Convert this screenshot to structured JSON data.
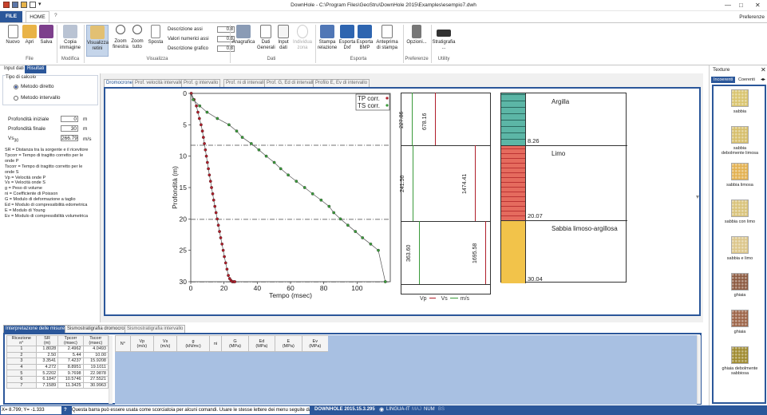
{
  "window": {
    "title": "DownHole - C:\\Program Files\\GeoStru\\DownHole 2015\\Examples\\esempio7.dwh"
  },
  "tabs": {
    "file": "FILE",
    "home": "HOME",
    "help": "?",
    "preferences": "Preferenze"
  },
  "ribbon": {
    "buttons": {
      "nuovo": "Nuovo",
      "apri": "Apri",
      "salva": "Salva",
      "copia": "Copia\nimmagine",
      "visualizza": "Visualizza\nretini",
      "zoomf": "Zoom\nfinestra",
      "zoomt": "Zoom\ntutto",
      "sposta": "Sposta",
      "anagrafica": "Anagrafica",
      "dati": "Dati\nGenerali",
      "input": "Input\ndati",
      "individua": "Individua\nzona",
      "stampa": "Stampa\nrelazione",
      "dxf": "Esporta\nDxf",
      "bmp": "Esporta\nBMP",
      "anteprima": "Anteprima\ndi stampa",
      "opzioni": "Opzioni...",
      "strat": "Stratigrafia\n..."
    },
    "fields": [
      {
        "label": "Descrizione assi",
        "value": "0.8"
      },
      {
        "label": "Valori numerici assi",
        "value": "0.8"
      },
      {
        "label": "Descrizione grafico",
        "value": "0.8"
      }
    ],
    "groups": {
      "file": "File",
      "modifica": "Modifica",
      "visualizza": "Visualizza",
      "dati": "Dati",
      "esporta": "Esporta",
      "preferenze": "Preferenze",
      "utility": "Utility"
    }
  },
  "left": {
    "tabs": [
      "Input dati",
      "Risultati"
    ],
    "section": "Tipo di calcolo",
    "radio": [
      "Metodo diretto",
      "Metodo intervallo"
    ],
    "params": [
      {
        "label": "Profondità iniziale",
        "value": "0",
        "unit": "m"
      },
      {
        "label": "Profondità finale",
        "value": "30",
        "unit": "m"
      },
      {
        "label": "Vs",
        "sub": "30",
        "value": "266.79",
        "unit": "m/s"
      }
    ],
    "legend": [
      "SR = Distanza tra la sorgente e il ricevitore",
      "Tpcorr = Tempo di tragitto corretto per le",
      "onde P",
      "Tscorr = Tempo di tragitto corretto per le",
      "onde S",
      "Vp = Velocità onde P",
      "Vs = Velocità onde S",
      "g = Peso di volume",
      "ni = Coefficiente di Poisson",
      "G = Modulo di deformazione a taglio",
      "Ed = Modulo di compressibilità edometrica",
      "E = Modulo di Young",
      "Ev = Modulo di compressibilità volumetrica"
    ]
  },
  "plot_tabs": [
    "Dromocrone",
    "Prof. velocità intervallo",
    "Prof. g intervallo",
    "Prof. ni di intervallo",
    "Prof. G, Ed di intervallo",
    "Profilo E, Ev di intervallo"
  ],
  "chart_data": {
    "type": "scatter",
    "xlabel": "Tempo (msec)",
    "ylabel": "Profondità (m)",
    "xlim": [
      0,
      120
    ],
    "ylim": [
      30,
      0
    ],
    "xticks": [
      "0",
      "20",
      "40",
      "60",
      "80",
      "100"
    ],
    "yticks": [
      "0",
      "5",
      "10",
      "15",
      "20",
      "25",
      "30"
    ],
    "legend_position": "top-right",
    "grid": false,
    "series": [
      {
        "name": "TP corr.",
        "color": "#b01e2a",
        "x": [
          0.3,
          2.0,
          3.4,
          4.3,
          5.2,
          6.2,
          7.0,
          7.6,
          8.2,
          8.8,
          9.4,
          10.0,
          10.6,
          11.2,
          11.9,
          12.5,
          13.2,
          13.8,
          14.5,
          15.2,
          15.9,
          16.6,
          17.3,
          18.0,
          18.8,
          19.5,
          20.2,
          21.0,
          21.8,
          22.6,
          23.4,
          24.2,
          25.0,
          25.8,
          26.5
        ],
        "y": [
          0,
          1,
          2,
          3,
          4,
          5,
          6,
          7,
          8,
          9,
          10,
          11,
          12,
          13,
          14,
          15,
          16,
          17,
          18,
          19,
          20,
          21,
          22,
          23,
          24,
          25,
          26,
          27,
          28,
          29,
          29.5,
          29.8,
          30,
          30,
          30
        ]
      },
      {
        "name": "TS corr.",
        "color": "#3a9a3a",
        "x": [
          1.5,
          5.4,
          9.8,
          16,
          23,
          27.6,
          31,
          36.4,
          41,
          45.4,
          50.2,
          54.1,
          58.6,
          63.5,
          68.5,
          73.3,
          78.4,
          83.2,
          86,
          90,
          94.5,
          99,
          103.3,
          108.2,
          112.8,
          117
        ],
        "y": [
          1,
          2,
          3,
          4,
          5,
          6,
          7,
          8,
          9,
          10,
          11,
          12,
          13,
          14,
          15,
          16,
          17,
          18,
          19,
          20,
          21,
          22,
          23,
          24,
          25,
          30
        ]
      }
    ],
    "annotations": [
      "8.26",
      "20.07",
      "30.04"
    ]
  },
  "strata": [
    {
      "name": "Argilla",
      "bottom": "8.26",
      "vp": "678.16",
      "vs": "227.86"
    },
    {
      "name": "Limo",
      "bottom": "20.07",
      "vp": "1474.41",
      "vs": "241.56"
    },
    {
      "name": "Sabbia limoso-argillosa",
      "bottom": "30.04",
      "vp": "1695.58",
      "vs": "363.60"
    }
  ],
  "vel_legend": {
    "vp": "Vp",
    "vs": "Vs",
    "unit": "m/s"
  },
  "bottom": {
    "tabs": [
      "Interpretazione delle misure",
      "Sismostratigrafia dromocrone",
      "Sismostratigrafia intervallo"
    ],
    "table1": {
      "headers": [
        "Ricezione\nn°",
        "SR\n(m)",
        "Tpcorr\n(msec)",
        "Tscorr\n(msec)"
      ],
      "rows": [
        [
          "1",
          "1.8028",
          "2.4962",
          "4.0493"
        ],
        [
          "2",
          "2.50",
          "5.44",
          "10.00"
        ],
        [
          "3",
          "3.3541",
          "7.4237",
          "15.9208"
        ],
        [
          "4",
          "4.272",
          "8.8951",
          "19.1011"
        ],
        [
          "5",
          "5.2202",
          "9.7698",
          "22.9878"
        ],
        [
          "6",
          "6.1847",
          "10.5746",
          "27.5521"
        ],
        [
          "7",
          "7.1589",
          "11.3425",
          "30.9963"
        ]
      ]
    },
    "table2": {
      "headers": [
        "N°",
        "Vp\n(m/s)",
        "Vs\n(m/s)",
        "g\n(kN/mc)",
        "ni",
        "G\n(MPa)",
        "Ed\n(MPa)",
        "E\n(MPa)",
        "Ev\n(MPa)"
      ]
    }
  },
  "right": {
    "title": "Texture",
    "tabs": [
      "Incoerenti",
      "Coerenti"
    ],
    "items": [
      "sabbia",
      "sabbia\ndebolmente limosa",
      "sabbia limosa",
      "sabbia con limo",
      "sabbia e limo",
      "ghiaia",
      "ghiaia",
      "ghiaia debolmente\nsabbiosa"
    ]
  },
  "status": {
    "coords": "X= 8.799; Y= -1.333",
    "hint": "Questa barra può essere usata come scorciatoia per alcuni comandi. Usare le stesse lettere dei menu seguite da invio.",
    "version": "DOWNHOLE 2015.15.3.295",
    "lang": "LINGUA-IT",
    "maj": "MAJ",
    "num": "NUM",
    "scr": "BS"
  }
}
